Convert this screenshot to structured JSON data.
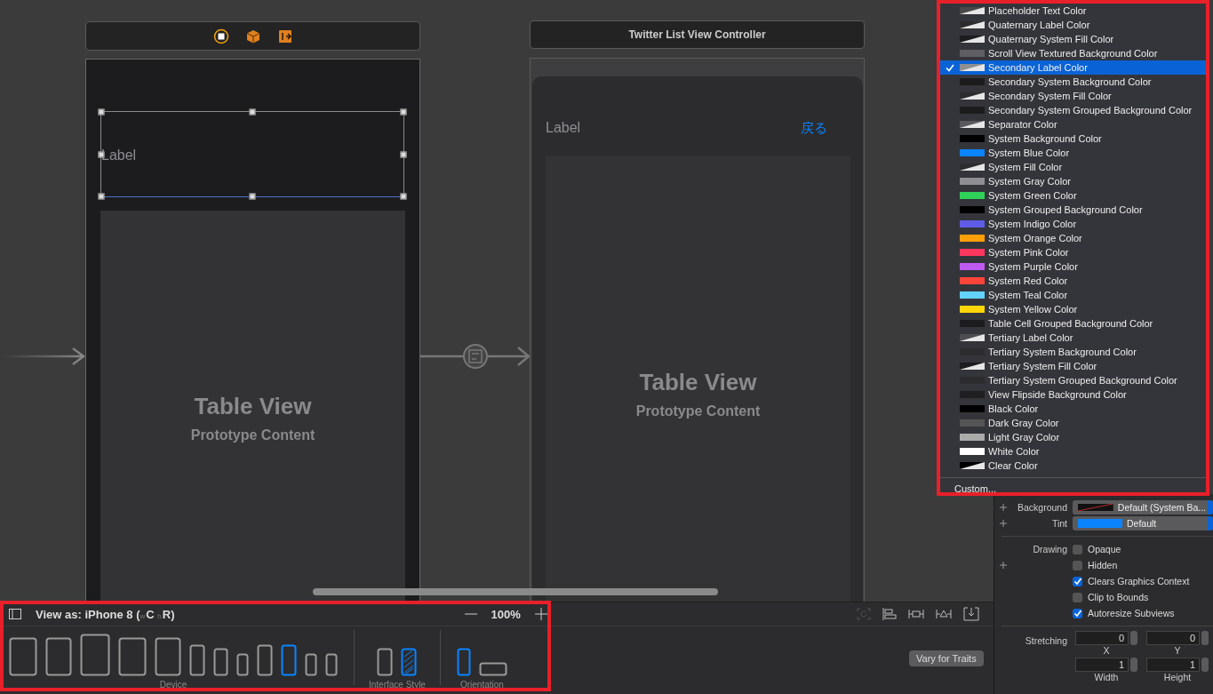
{
  "canvas": {
    "scene_1": {
      "label": "Label",
      "table_title": "Table View",
      "table_subtitle": "Prototype Content"
    },
    "scene_2": {
      "title": "Twitter List View Controller",
      "label": "Label",
      "back_button": "戻る",
      "table_title": "Table View",
      "table_subtitle": "Prototype Content"
    }
  },
  "color_menu": {
    "items": [
      {
        "label": "Placeholder Text Color",
        "kind": "gradient",
        "color": "#48484a",
        "selected": false
      },
      {
        "label": "Quaternary Label Color",
        "kind": "gradient",
        "color": "#2c2c2e",
        "selected": false
      },
      {
        "label": "Quaternary System Fill Color",
        "kind": "gradient",
        "color": "#1c1c1e",
        "selected": false
      },
      {
        "label": "Scroll View Textured Background Color",
        "kind": "solid",
        "color": "#5f5f63",
        "selected": false
      },
      {
        "label": "Secondary Label Color",
        "kind": "gradient",
        "color": "#8e8e93",
        "selected": true
      },
      {
        "label": "Secondary System Background Color",
        "kind": "solid",
        "color": "#1c1c1e",
        "selected": false
      },
      {
        "label": "Secondary System Fill Color",
        "kind": "gradient",
        "color": "#2c2c2e",
        "selected": false
      },
      {
        "label": "Secondary System Grouped Background Color",
        "kind": "solid",
        "color": "#1c1c1d",
        "selected": false
      },
      {
        "label": "Separator Color",
        "kind": "gradient",
        "color": "#5a5a5e",
        "selected": false
      },
      {
        "label": "System Background Color",
        "kind": "solid",
        "color": "#000000",
        "selected": false
      },
      {
        "label": "System Blue Color",
        "kind": "solid",
        "color": "#0a84ff",
        "selected": false
      },
      {
        "label": "System Fill Color",
        "kind": "gradient",
        "color": "#2c2c2f",
        "selected": false
      },
      {
        "label": "System Gray Color",
        "kind": "solid",
        "color": "#8e8e93",
        "selected": false
      },
      {
        "label": "System Green Color",
        "kind": "solid",
        "color": "#30d158",
        "selected": false
      },
      {
        "label": "System Grouped Background Color",
        "kind": "solid",
        "color": "#000001",
        "selected": false
      },
      {
        "label": "System Indigo Color",
        "kind": "solid",
        "color": "#5e5ce6",
        "selected": false
      },
      {
        "label": "System Orange Color",
        "kind": "solid",
        "color": "#ff9f0a",
        "selected": false
      },
      {
        "label": "System Pink Color",
        "kind": "solid",
        "color": "#ff375f",
        "selected": false
      },
      {
        "label": "System Purple Color",
        "kind": "solid",
        "color": "#bf5af2",
        "selected": false
      },
      {
        "label": "System Red Color",
        "kind": "solid",
        "color": "#ff453a",
        "selected": false
      },
      {
        "label": "System Teal Color",
        "kind": "solid",
        "color": "#64d2ff",
        "selected": false
      },
      {
        "label": "System Yellow Color",
        "kind": "solid",
        "color": "#ffd60a",
        "selected": false
      },
      {
        "label": "Table Cell Grouped Background Color",
        "kind": "solid",
        "color": "#1c1c1f",
        "selected": false
      },
      {
        "label": "Tertiary Label Color",
        "kind": "gradient",
        "color": "#4e4e52",
        "selected": false
      },
      {
        "label": "Tertiary System Background Color",
        "kind": "solid",
        "color": "#2c2c2e",
        "selected": false
      },
      {
        "label": "Tertiary System Fill Color",
        "kind": "gradient",
        "color": "#1c1c20",
        "selected": false
      },
      {
        "label": "Tertiary System Grouped Background Color",
        "kind": "solid",
        "color": "#2c2c2f",
        "selected": false
      },
      {
        "label": "View Flipside Background Color",
        "kind": "solid",
        "color": "#1f1f21",
        "selected": false
      },
      {
        "label": "Black Color",
        "kind": "solid",
        "color": "#000002",
        "selected": false
      },
      {
        "label": "Dark Gray Color",
        "kind": "solid",
        "color": "#555555",
        "selected": false
      },
      {
        "label": "Light Gray Color",
        "kind": "solid",
        "color": "#aaaaaa",
        "selected": false
      },
      {
        "label": "White Color",
        "kind": "solid",
        "color": "#ffffff",
        "selected": false
      },
      {
        "label": "Clear Color",
        "kind": "gradient",
        "color": "#000003",
        "selected": false
      }
    ],
    "custom": "Custom..."
  },
  "inspector": {
    "popups": [
      {
        "label": "Background",
        "value": "Default (System Ba...",
        "kind": "no-color"
      },
      {
        "label": "Tint",
        "value": "Default",
        "kind": "solid",
        "color": "#0a84ff"
      }
    ],
    "drawing_label": "Drawing",
    "checkboxes": [
      {
        "label": "Opaque",
        "checked": false,
        "plus": false
      },
      {
        "label": "Hidden",
        "checked": false,
        "plus": true
      },
      {
        "label": "Clears Graphics Context",
        "checked": true,
        "plus": false
      },
      {
        "label": "Clip to Bounds",
        "checked": false,
        "plus": false
      },
      {
        "label": "Autoresize Subviews",
        "checked": true,
        "plus": false
      }
    ],
    "stretching_label": "Stretching",
    "stretching": [
      {
        "value": "0",
        "caption": "X"
      },
      {
        "value": "0",
        "caption": "Y"
      },
      {
        "value": "1",
        "caption": "Width"
      },
      {
        "value": "1",
        "caption": "Height"
      }
    ]
  },
  "bottom_bar": {
    "view_as": "View as: iPhone 8 (",
    "size_class": [
      {
        "prefix": "w",
        "value": "C"
      },
      {
        "prefix": "h",
        "value": "R"
      }
    ],
    "close_paren": ")",
    "zoom": "100%",
    "vary_button": "Vary for Traits",
    "devices": [
      {
        "kind": "tablet-large",
        "selected": false
      },
      {
        "kind": "tablet",
        "selected": false
      },
      {
        "kind": "tablet-xl",
        "selected": false
      },
      {
        "kind": "tablet-large",
        "selected": false
      },
      {
        "kind": "tablet",
        "selected": false
      },
      {
        "kind": "phone-large",
        "selected": false
      },
      {
        "kind": "phone",
        "selected": false
      },
      {
        "kind": "phone-small",
        "selected": false
      },
      {
        "kind": "phone-large",
        "selected": false
      },
      {
        "kind": "phone-large",
        "selected": true
      },
      {
        "kind": "phone-small",
        "selected": false
      },
      {
        "kind": "phone-small",
        "selected": false
      }
    ],
    "device_caption": "Device",
    "styles": [
      {
        "kind": "light",
        "selected": false
      },
      {
        "kind": "dark",
        "selected": true
      }
    ],
    "style_caption": "Interface Style",
    "orientations": [
      {
        "kind": "portrait",
        "selected": true
      },
      {
        "kind": "landscape",
        "selected": false
      }
    ],
    "orientation_caption": "Orientation"
  }
}
